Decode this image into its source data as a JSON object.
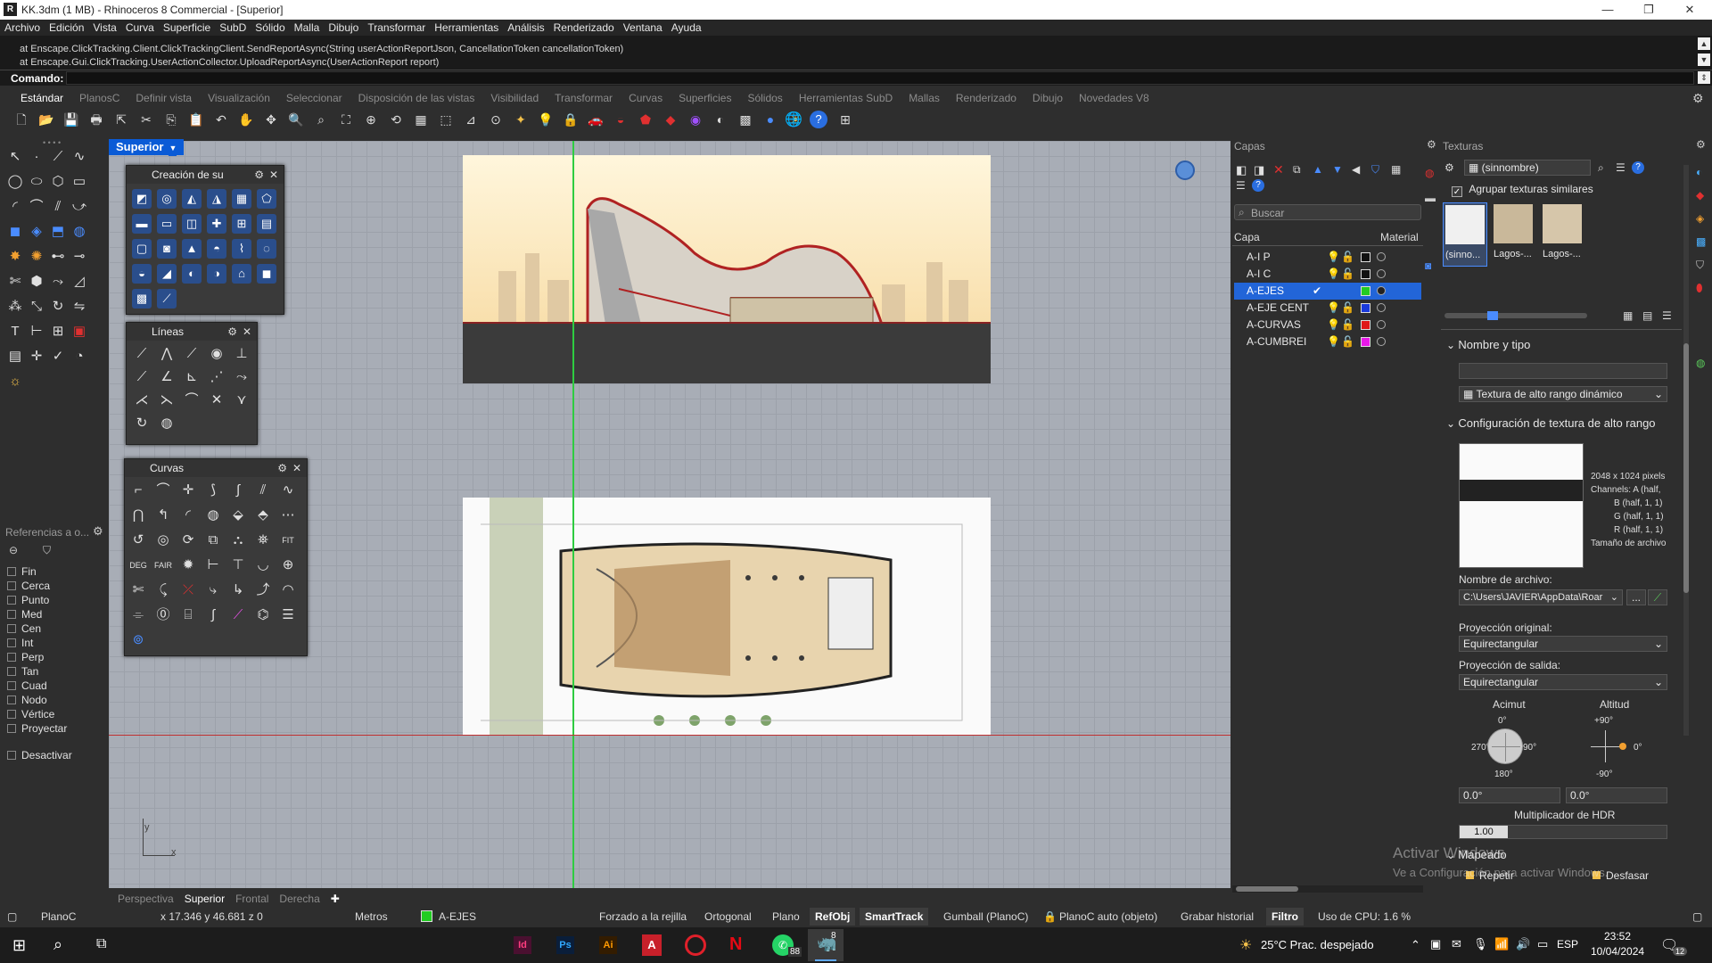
{
  "window": {
    "title": "KK.3dm (1 MB) - Rhinoceros 8 Commercial - [Superior]",
    "min": "—",
    "restore": "❐",
    "close": "✕"
  },
  "menu": [
    "Archivo",
    "Edición",
    "Vista",
    "Curva",
    "Superficie",
    "SubD",
    "Sólido",
    "Malla",
    "Dibujo",
    "Transformar",
    "Herramientas",
    "Análisis",
    "Renderizado",
    "Ventana",
    "Ayuda"
  ],
  "command_history": [
    "at Enscape.ClickTracking.Client.ClickTrackingClient.SendReportAsync(String userActionReportJson, CancellationToken cancellationToken)",
    "at Enscape.Gui.ClickTracking.UserActionCollector.UploadReportAsync(UserActionReport report)"
  ],
  "command": {
    "label": "Comando:",
    "value": ""
  },
  "toolbar_tabs": [
    "Estándar",
    "PlanosC",
    "Definir vista",
    "Visualización",
    "Seleccionar",
    "Disposición de las vistas",
    "Visibilidad",
    "Transformar",
    "Curvas",
    "Superficies",
    "Sólidos",
    "Herramientas SubD",
    "Mallas",
    "Renderizado",
    "Dibujo",
    "Novedades V8"
  ],
  "active_toolbar_tab": "Estándar",
  "viewport": {
    "name": "Superior"
  },
  "float_panels": {
    "creation": "Creación de su",
    "lines": "Líneas",
    "curves": "Curvas"
  },
  "osnap": {
    "header": "Referencias a o...",
    "items": [
      "Fin",
      "Cerca",
      "Punto",
      "Med",
      "Cen",
      "Int",
      "Perp",
      "Tan",
      "Cuad",
      "Nodo",
      "Vértice",
      "Proyectar"
    ],
    "disable": "Desactivar"
  },
  "viewport_tabs": [
    "Perspectiva",
    "Superior",
    "Frontal",
    "Derecha"
  ],
  "active_viewport_tab": "Superior",
  "axis": {
    "x": "x",
    "y": "y"
  },
  "status": {
    "plane": "PlanoC",
    "coords": "x 17.346   y 46.681   z 0",
    "units": "Metros",
    "layer": "A-EJES",
    "grid_snap": "Forzado a la rejilla",
    "ortho": "Ortogonal",
    "planar": "Plano",
    "osnap": "RefObj",
    "smarttrack": "SmartTrack",
    "gumball": "Gumball (PlanoC)",
    "autocplane": "PlanoC auto (objeto)",
    "history": "Grabar historial",
    "filter": "Filtro",
    "cpu": "Uso de CPU: 1.6 %"
  },
  "layers": {
    "title": "Capas",
    "search_placeholder": "Buscar",
    "col_layer": "Capa",
    "col_material": "Material",
    "rows": [
      {
        "name": "A-I P",
        "color": "#111111"
      },
      {
        "name": "A-I C",
        "color": "#111111"
      },
      {
        "name": "A-EJES",
        "color": "#22cc22",
        "current": true
      },
      {
        "name": "A-EJE CENT",
        "color": "#1a3adc"
      },
      {
        "name": "A-CURVAS",
        "color": "#e01818"
      },
      {
        "name": "A-CUMBREI",
        "color": "#e818e8"
      }
    ]
  },
  "textures": {
    "title": "Texturas",
    "selected": "(sinnombre)",
    "group_similar": "Agrupar texturas similares",
    "thumbs": [
      "(sinno...",
      "Lagos-...",
      "Lagos-..."
    ],
    "section_name": "Nombre y tipo",
    "name_value": "",
    "type_value": "Textura de alto rango dinámico",
    "section_hdr": "Configuración de textura de alto rango",
    "info": [
      "2048 x 1024 pixels",
      "Channels:  A (half,",
      "B (half, 1, 1)",
      "G (half, 1, 1)",
      "R (half, 1, 1)",
      "Tamaño de archivo"
    ],
    "filename_label": "Nombre de archivo:",
    "filename_value": "C:\\Users\\JAVIER\\AppData\\Roar",
    "browse": "...",
    "proj_in_label": "Proyección original:",
    "proj_in_value": "Equirectangular",
    "proj_out_label": "Proyección de salida:",
    "proj_out_value": "Equirectangular",
    "azimuth_label": "Acimut",
    "altitude_label": "Altitud",
    "az_ticks": {
      "top": "0°",
      "left": "270°",
      "right": "90°",
      "bottom": "180°"
    },
    "alt_ticks": {
      "top": "+90°",
      "right": "0°",
      "bottom": "-90°"
    },
    "azimuth_value": "0.0°",
    "altitude_value": "0.0°",
    "hdr_mult_label": "Multiplicador de HDR",
    "hdr_mult_value": "1.00",
    "mapping_label": "Mapeado",
    "repeat": "Repetir",
    "offset": "Desfasar",
    "watermark1": "Activar Windows",
    "watermark2": "Ve a Configuración para activar Windows."
  },
  "taskbar": {
    "weather": "25°C  Prac. despejado",
    "lang": "ESP",
    "time": "23:52",
    "date": "10/04/2024",
    "whatsapp_badge": "88",
    "rhino_badge": "8",
    "notif_badge": "12"
  }
}
